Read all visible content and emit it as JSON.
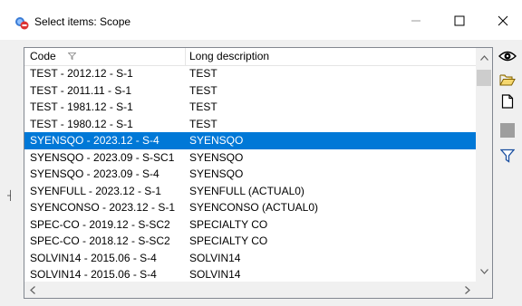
{
  "window": {
    "title": "Select items: Scope"
  },
  "titlebar": {
    "minimize": "—",
    "maximize": "☐",
    "close": "✕"
  },
  "list": {
    "columns": {
      "code": "Code",
      "description": "Long description"
    },
    "rows": [
      {
        "code": "TEST - 2012.12 - S-1",
        "description": "TEST",
        "selected": false
      },
      {
        "code": "TEST - 2011.11 - S-1",
        "description": "TEST",
        "selected": false
      },
      {
        "code": "TEST - 1981.12 - S-1",
        "description": "TEST",
        "selected": false
      },
      {
        "code": "TEST - 1980.12 - S-1",
        "description": "TEST",
        "selected": false
      },
      {
        "code": "SYENSQO - 2023.12 - S-4",
        "description": "SYENSQO",
        "selected": true
      },
      {
        "code": "SYENSQO - 2023.09 - S-SC1",
        "description": "SYENSQO",
        "selected": false
      },
      {
        "code": "SYENSQO - 2023.09 - S-4",
        "description": "SYENSQO",
        "selected": false
      },
      {
        "code": "SYENFULL - 2023.12 - S-1",
        "description": "SYENFULL (ACTUAL0)",
        "selected": false
      },
      {
        "code": "SYENCONSO - 2023.12 - S-1",
        "description": "SYENCONSO (ACTUAL0)",
        "selected": false
      },
      {
        "code": "SPEC-CO - 2019.12 - S-SC2",
        "description": "SPECIALTY CO",
        "selected": false
      },
      {
        "code": "SPEC-CO - 2018.12 - S-SC2",
        "description": "SPECIALTY CO",
        "selected": false
      },
      {
        "code": "SOLVIN14 - 2015.06 - S-4",
        "description": "SOLVIN14",
        "selected": false
      },
      {
        "code": "SOLVIN14 - 2015.06 - S-4",
        "description": "SOLVIN14",
        "selected": false
      }
    ]
  },
  "sidebar": {
    "buttons": [
      {
        "name": "view-eye-icon"
      },
      {
        "name": "open-folder-icon"
      },
      {
        "name": "new-document-icon"
      },
      {
        "name": "stop-icon"
      },
      {
        "name": "filter-icon"
      }
    ]
  },
  "colors": {
    "selection": "#0078d7",
    "border": "#828790"
  }
}
